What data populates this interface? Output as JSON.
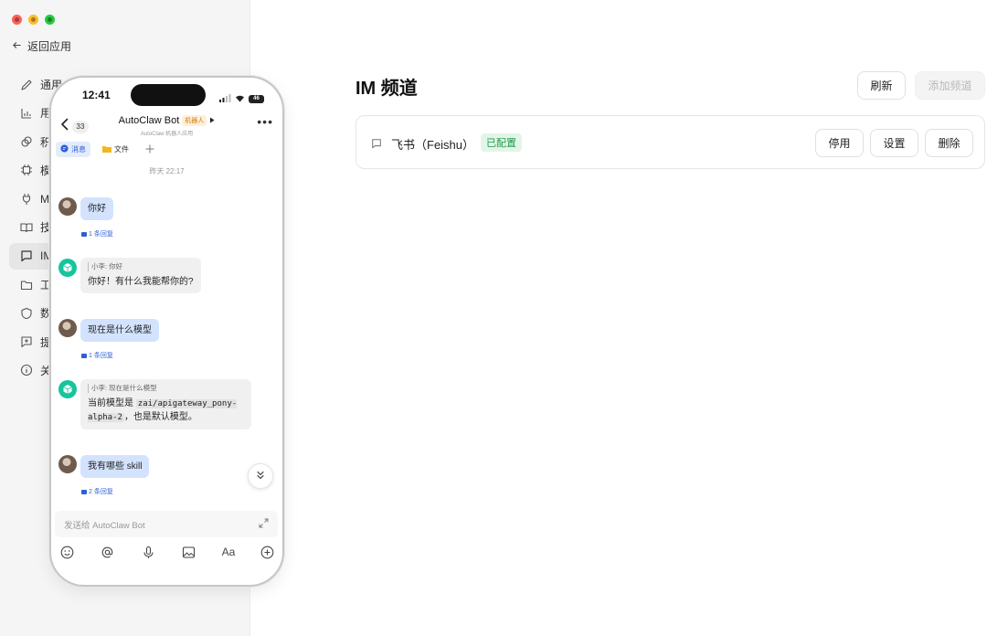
{
  "window": {
    "controls": [
      "close",
      "minimize",
      "zoom"
    ]
  },
  "sidebar": {
    "back_label": "返回应用",
    "items": [
      {
        "label": "通用",
        "icon": "pencil-icon",
        "active": false
      },
      {
        "label": "用",
        "icon": "chart-icon",
        "active": false
      },
      {
        "label": "积",
        "icon": "coins-icon",
        "active": false
      },
      {
        "label": "模",
        "icon": "chip-icon",
        "active": false
      },
      {
        "label": "M",
        "icon": "plug-icon",
        "active": false
      },
      {
        "label": "技",
        "icon": "book-icon",
        "active": false
      },
      {
        "label": "IM",
        "icon": "chat-icon",
        "active": true
      },
      {
        "label": "工",
        "icon": "folder-icon",
        "active": false
      },
      {
        "label": "数",
        "icon": "shield-icon",
        "active": false
      },
      {
        "label": "提",
        "icon": "plus-box-icon",
        "active": false
      },
      {
        "label": "关",
        "icon": "info-icon",
        "active": false
      }
    ]
  },
  "main": {
    "title": "IM 频道",
    "refresh_label": "刷新",
    "add_channel_label": "添加频道",
    "channel": {
      "name": "飞书（Feishu）",
      "status": "已配置",
      "disable_label": "停用",
      "settings_label": "设置",
      "delete_label": "删除"
    }
  },
  "phone": {
    "time": "12:41",
    "battery": "46",
    "unread_count": "33",
    "chat_title": "AutoClaw Bot",
    "bot_tag": "机器人",
    "chat_subtitle": "AutoClaw 机器人应用",
    "tabs": {
      "messages": "消息",
      "files": "文件"
    },
    "date": "昨天 22:17",
    "messages": [
      {
        "text": "你好",
        "reply": "1 条回复"
      },
      {
        "quote": "小李: 你好",
        "text": "你好！有什么我能帮你的?"
      },
      {
        "text": "现在是什么模型",
        "reply": "1 条回复"
      },
      {
        "quote": "小李: 现在是什么模型",
        "text_prefix": "当前模型是",
        "code": "zai/apigateway_pony-alpha-2",
        "text_suffix": "，也是默认模型。"
      },
      {
        "text": "我有哪些 skill",
        "reply": "2 条回复"
      }
    ],
    "input_placeholder": "发送给 AutoClaw Bot",
    "font_tool_label": "Aa"
  }
}
